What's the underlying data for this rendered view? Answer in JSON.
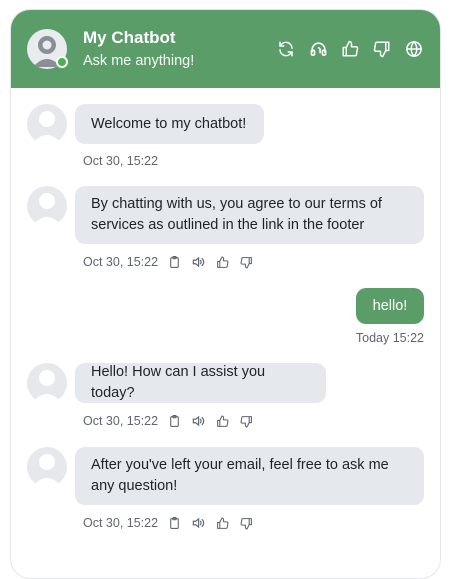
{
  "header": {
    "title": "My Chatbot",
    "subtitle": "Ask me anything!",
    "accent_color": "#5a9d68",
    "status_color": "#4caf50",
    "icons": [
      "refresh-icon",
      "headset-icon",
      "thumbs-up-icon",
      "thumbs-down-icon",
      "globe-icon"
    ]
  },
  "messages": [
    {
      "sender": "bot",
      "text": "Welcome to my chatbot!",
      "time": "Oct 30, 15:22",
      "actions": []
    },
    {
      "sender": "bot",
      "text": "By chatting with us, you agree to our terms of services as outlined in the link in the footer",
      "time": "Oct 30, 15:22",
      "actions": [
        "copy-icon",
        "speaker-icon",
        "thumbs-up-icon",
        "thumbs-down-icon"
      ]
    },
    {
      "sender": "user",
      "text": "hello!",
      "time": "Today 15:22"
    },
    {
      "sender": "bot",
      "text": "Hello! How can I assist you today?",
      "time": "Oct 30, 15:22",
      "actions": [
        "copy-icon",
        "speaker-icon",
        "thumbs-up-icon",
        "thumbs-down-icon"
      ]
    },
    {
      "sender": "bot",
      "text": "After you've left your email, feel free to ask me any question!",
      "time": "Oct 30, 15:22",
      "actions": [
        "copy-icon",
        "speaker-icon",
        "thumbs-up-icon",
        "thumbs-down-icon"
      ]
    }
  ]
}
